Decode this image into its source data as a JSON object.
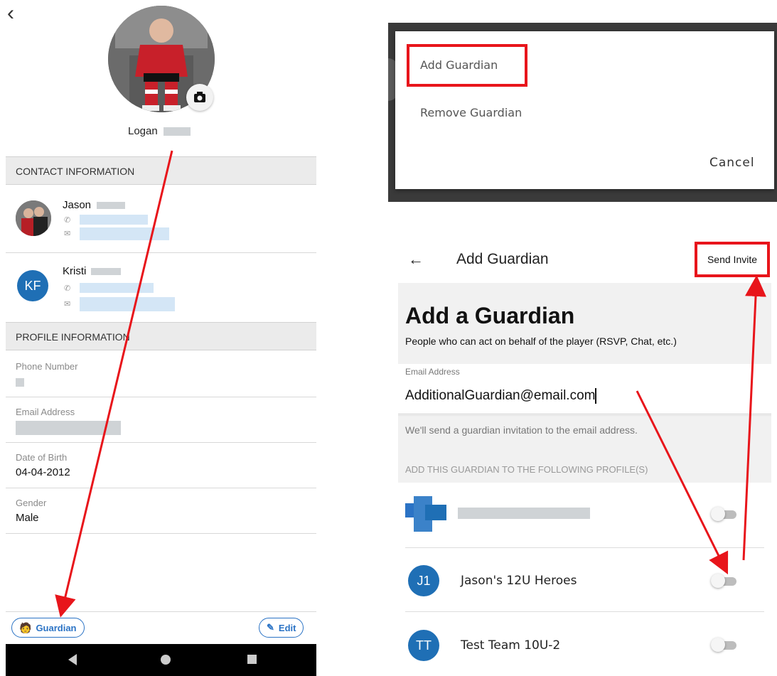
{
  "left": {
    "back_icon": "chevron-left-icon",
    "player_name": "Logan",
    "contact_section": "CONTACT INFORMATION",
    "contacts": [
      {
        "name": "Jason",
        "initials": ""
      },
      {
        "name": "Kristi",
        "initials": "KF"
      }
    ],
    "profile_section": "PROFILE INFORMATION",
    "fields": [
      {
        "label": "Phone Number",
        "value": ""
      },
      {
        "label": "Email Address",
        "value": ""
      },
      {
        "label": "Date of Birth",
        "value": "04-04-2012"
      },
      {
        "label": "Gender",
        "value": "Male"
      }
    ],
    "guardian_button": "Guardian",
    "edit_button": "Edit"
  },
  "dialog": {
    "add_guardian": "Add Guardian",
    "remove_guardian": "Remove Guardian",
    "cancel": "Cancel"
  },
  "add_guardian_screen": {
    "header_title": "Add Guardian",
    "send_invite": "Send Invite",
    "title": "Add a Guardian",
    "subtitle": "People who can act on behalf of the player (RSVP, Chat, etc.)",
    "email_label": "Email Address",
    "email_value": "AdditionalGuardian@email.com",
    "note": "We'll send a guardian invitation to the email address.",
    "profiles_header": "ADD THIS GUARDIAN TO THE FOLLOWING PROFILE(S)",
    "teams": [
      {
        "initials": "",
        "name": ""
      },
      {
        "initials": "J1",
        "name": "Jason's 12U Heroes"
      },
      {
        "initials": "TT",
        "name": "Test Team 10U-2"
      }
    ]
  },
  "colors": {
    "accent": "#2b73c5",
    "annotation": "#e8151b",
    "badge": "#1f6fb5"
  }
}
